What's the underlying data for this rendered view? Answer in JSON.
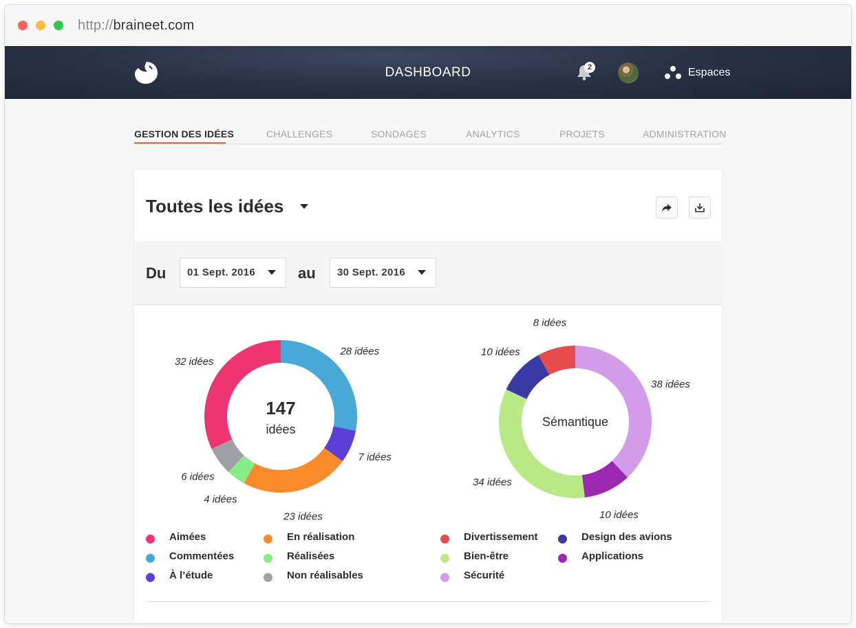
{
  "browser": {
    "url_protocol": "http://",
    "url_host": "braineet.com"
  },
  "navbar": {
    "title": "DASHBOARD",
    "notification_count": "2",
    "espaces_label": "Espaces"
  },
  "tabs": [
    {
      "label": "GESTION DES IDÉES",
      "active": true
    },
    {
      "label": "CHALLENGES",
      "active": false
    },
    {
      "label": "SONDAGES",
      "active": false
    },
    {
      "label": "ANALYTICS",
      "active": false
    },
    {
      "label": "PROJETS",
      "active": false
    },
    {
      "label": "ADMINISTRATION",
      "active": false
    }
  ],
  "card": {
    "title": "Toutes les idées",
    "filter": {
      "from_label": "Du",
      "from_value": "01 Sept. 2016",
      "to_label": "au",
      "to_value": "30 Sept. 2016"
    }
  },
  "chart_data": [
    {
      "type": "pie",
      "variant": "donut",
      "center_value": "147",
      "center_label": "idées",
      "slices": [
        {
          "name": "Commentées",
          "value": 28,
          "label": "28 idées",
          "color": "#48a9d6"
        },
        {
          "name": "À l'étude",
          "value": 7,
          "label": "7 idées",
          "color": "#5b3fd6"
        },
        {
          "name": "En réalisation",
          "value": 23,
          "label": "23 idées",
          "color": "#fb8a2a"
        },
        {
          "name": "Réalisées",
          "value": 4,
          "label": "4 idées",
          "color": "#86ec86"
        },
        {
          "name": "Non réalisables",
          "value": 6,
          "label": "6 idées",
          "color": "#9fa0a6"
        },
        {
          "name": "Aimées",
          "value": 32,
          "label": "32 idées",
          "color": "#ee3572"
        }
      ],
      "legend": [
        {
          "name": "Aimées",
          "color": "#ee3572"
        },
        {
          "name": "Commentées",
          "color": "#48a9d6"
        },
        {
          "name": "À l’étude",
          "color": "#5b3fd6"
        },
        {
          "name": "En réalisation",
          "color": "#fb8a2a"
        },
        {
          "name": "Réalisées",
          "color": "#86ec86"
        },
        {
          "name": "Non réalisables",
          "color": "#9fa0a6"
        }
      ]
    },
    {
      "type": "pie",
      "variant": "donut",
      "center_label": "Sémantique",
      "slices": [
        {
          "name": "Sécurité",
          "value": 38,
          "label": "38 idées",
          "color": "#d39cea"
        },
        {
          "name": "Applications",
          "value": 10,
          "label": "10 idées",
          "color": "#9c27b0"
        },
        {
          "name": "Bien-être",
          "value": 34,
          "label": "34 idées",
          "color": "#b9e986"
        },
        {
          "name": "Design des avions",
          "value": 10,
          "label": "10 idées",
          "color": "#3a3aa5"
        },
        {
          "name": "Divertissement",
          "value": 8,
          "label": "8 idées",
          "color": "#e64c4c"
        }
      ],
      "legend": [
        {
          "name": "Divertissement",
          "color": "#e64c4c"
        },
        {
          "name": "Bien-être",
          "color": "#b9e986"
        },
        {
          "name": "Sécurité",
          "color": "#d39cea"
        },
        {
          "name": "Design des avions",
          "color": "#3a3aa5"
        },
        {
          "name": "Applications",
          "color": "#9c27b0"
        }
      ]
    }
  ]
}
